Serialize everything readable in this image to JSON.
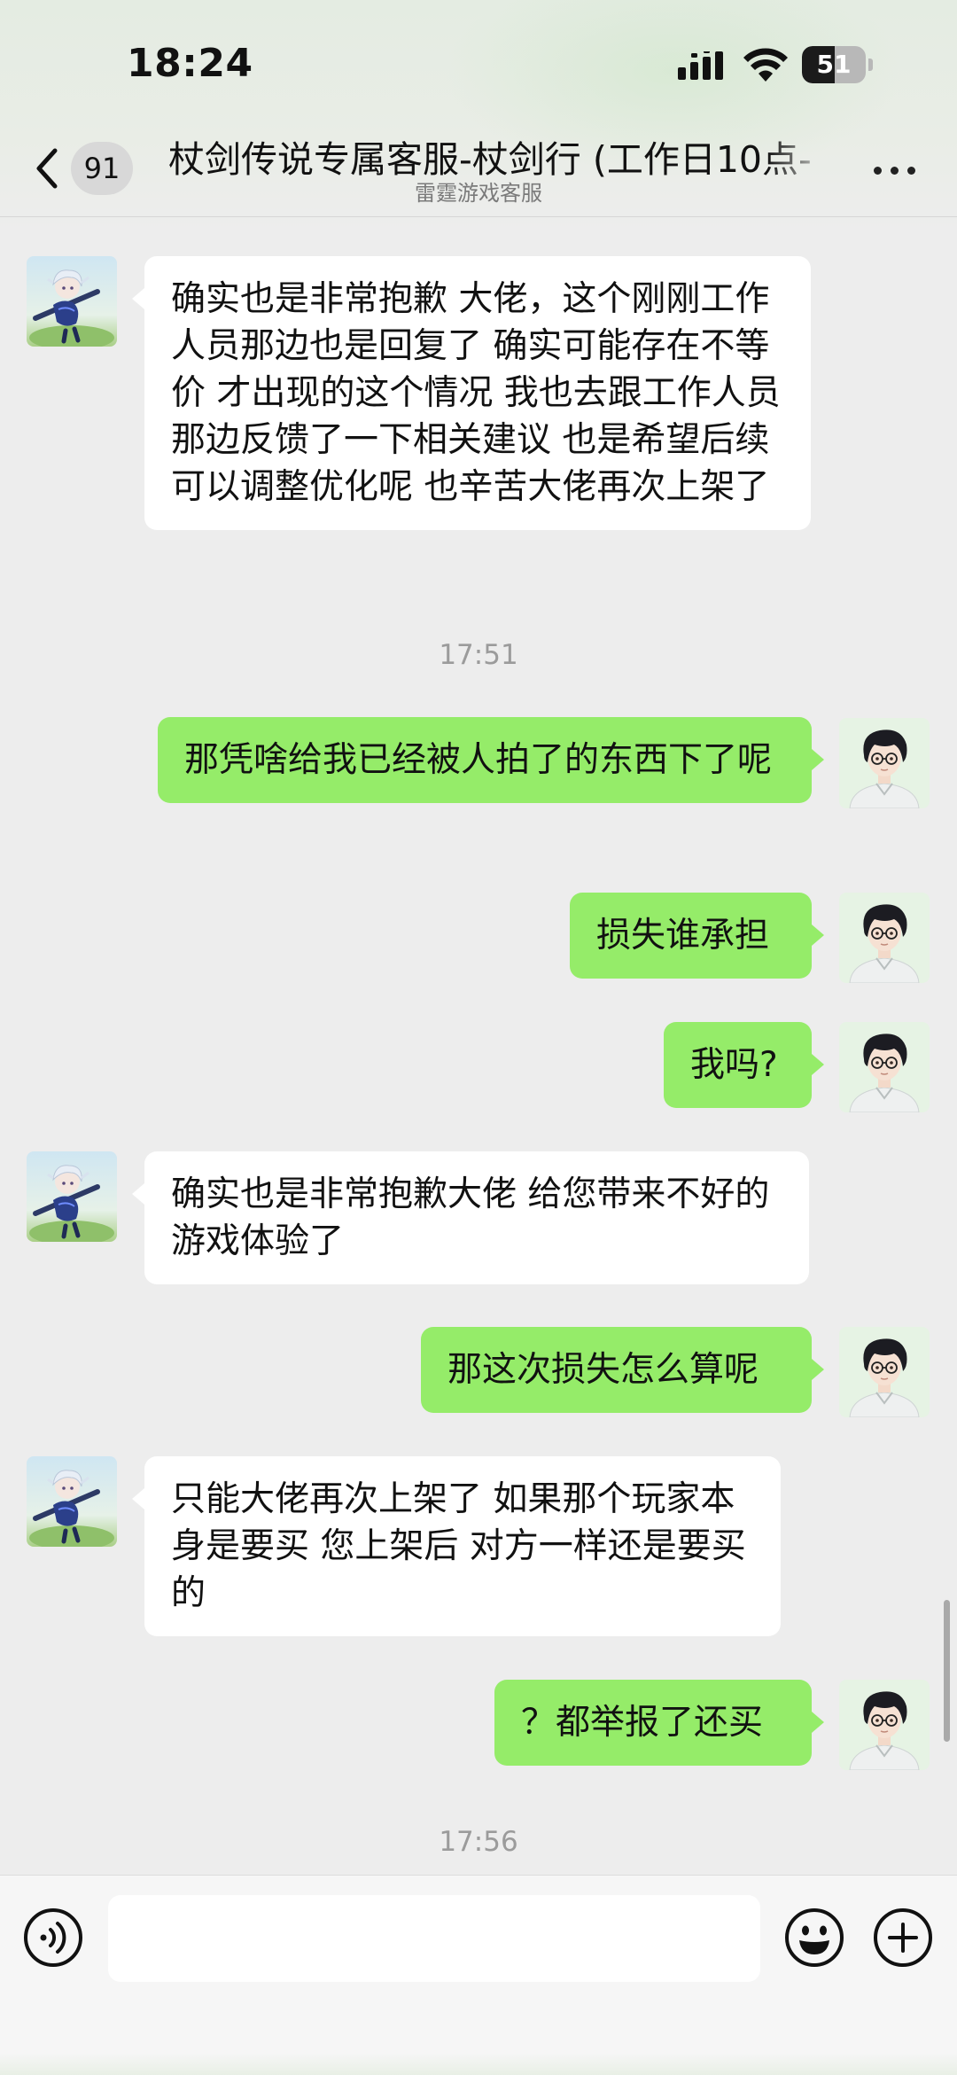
{
  "status_bar": {
    "time": "18:24",
    "battery_level": "51",
    "battery_fraction": 0.51,
    "icons": [
      "signal-icon",
      "wifi-icon",
      "battery-icon"
    ]
  },
  "nav": {
    "back_icon": "chevron-left-icon",
    "unread_count": "91",
    "title": "杖剑传说专属客服-杖剑行 (工作日10点-",
    "subtitle": "雷霆游戏客服",
    "more_icon": "more-icon"
  },
  "messages": [
    {
      "side": "left",
      "text": "确实也是非常抱歉 大佬，这个刚刚工作人员那边也是回复了 确实可能存在不等价 才出现的这个情况 我也去跟工作人员那边反馈了一下相关建议 也是希望后续可以调整优化呢  也辛苦大佬再次上架了"
    },
    {
      "type": "time",
      "text": "17:51"
    },
    {
      "side": "right",
      "text": "那凭啥给我已经被人拍了的东西下了呢"
    },
    {
      "side": "right",
      "text": "损失谁承担"
    },
    {
      "side": "right",
      "text": "我吗?"
    },
    {
      "side": "left",
      "text": "确实也是非常抱歉大佬 给您带来不好的游戏体验了"
    },
    {
      "side": "right",
      "text": "那这次损失怎么算呢"
    },
    {
      "side": "left",
      "text": "只能大佬再次上架了  如果那个玩家本身是要买 您上架后 对方一样还是要买的"
    },
    {
      "side": "right",
      "text": "？都举报了还买"
    },
    {
      "type": "time",
      "text": "17:56"
    }
  ],
  "input_bar": {
    "voice_icon": "voice-icon",
    "input_value": "",
    "emoji_icon": "emoji-icon",
    "plus_icon": "plus-icon"
  },
  "colors": {
    "background": "#ededed",
    "bubble_sent": "#95ec69",
    "bubble_received": "#ffffff",
    "timestamp": "#9b9b9b"
  }
}
